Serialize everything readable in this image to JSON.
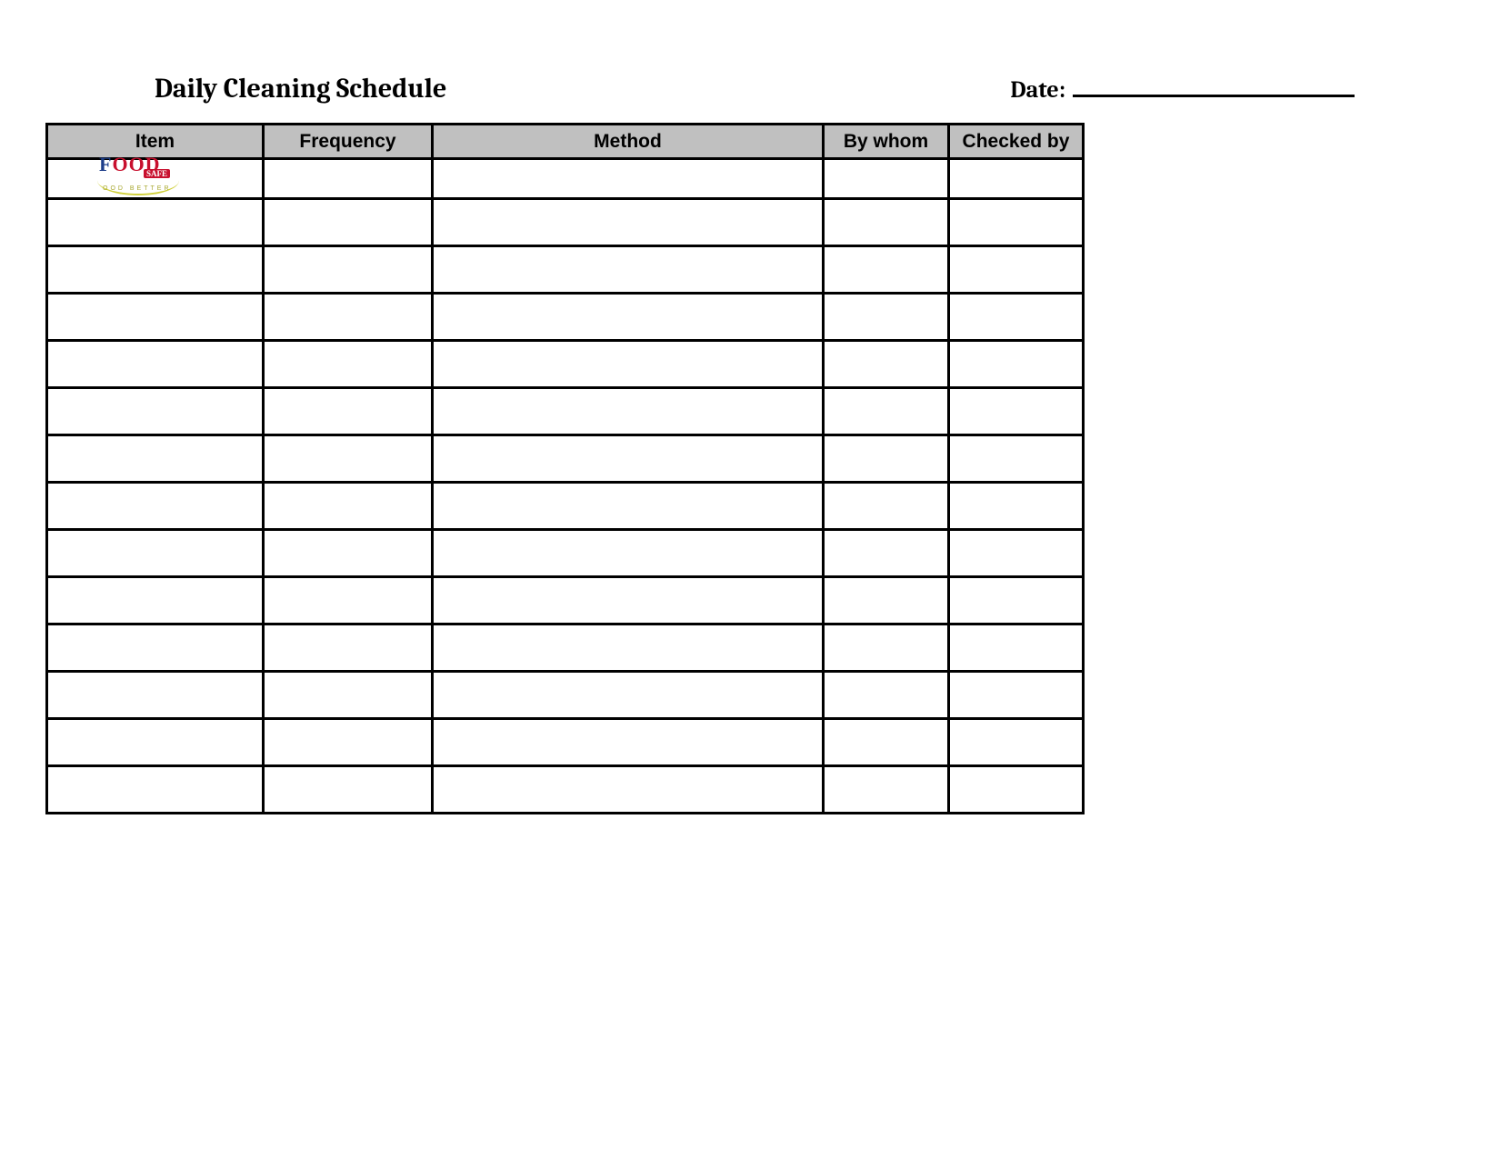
{
  "header": {
    "title": "Daily Cleaning Schedule",
    "date_label": "Date:",
    "date_value": ""
  },
  "logo": {
    "line1_part1": "F",
    "line1_part2": "OOD",
    "safe": "SAFE",
    "sub": "OOD BETTER"
  },
  "table": {
    "columns": [
      "Item",
      "Frequency",
      "Method",
      "By whom",
      "Checked by"
    ],
    "rows": [
      {
        "item": "",
        "frequency": "",
        "method": "",
        "by_whom": "",
        "checked_by": ""
      },
      {
        "item": "",
        "frequency": "",
        "method": "",
        "by_whom": "",
        "checked_by": ""
      },
      {
        "item": "",
        "frequency": "",
        "method": "",
        "by_whom": "",
        "checked_by": ""
      },
      {
        "item": "",
        "frequency": "",
        "method": "",
        "by_whom": "",
        "checked_by": ""
      },
      {
        "item": "",
        "frequency": "",
        "method": "",
        "by_whom": "",
        "checked_by": ""
      },
      {
        "item": "",
        "frequency": "",
        "method": "",
        "by_whom": "",
        "checked_by": ""
      },
      {
        "item": "",
        "frequency": "",
        "method": "",
        "by_whom": "",
        "checked_by": ""
      },
      {
        "item": "",
        "frequency": "",
        "method": "",
        "by_whom": "",
        "checked_by": ""
      },
      {
        "item": "",
        "frequency": "",
        "method": "",
        "by_whom": "",
        "checked_by": ""
      },
      {
        "item": "",
        "frequency": "",
        "method": "",
        "by_whom": "",
        "checked_by": ""
      },
      {
        "item": "",
        "frequency": "",
        "method": "",
        "by_whom": "",
        "checked_by": ""
      },
      {
        "item": "",
        "frequency": "",
        "method": "",
        "by_whom": "",
        "checked_by": ""
      },
      {
        "item": "",
        "frequency": "",
        "method": "",
        "by_whom": "",
        "checked_by": ""
      },
      {
        "item": "",
        "frequency": "",
        "method": "",
        "by_whom": "",
        "checked_by": ""
      }
    ]
  }
}
